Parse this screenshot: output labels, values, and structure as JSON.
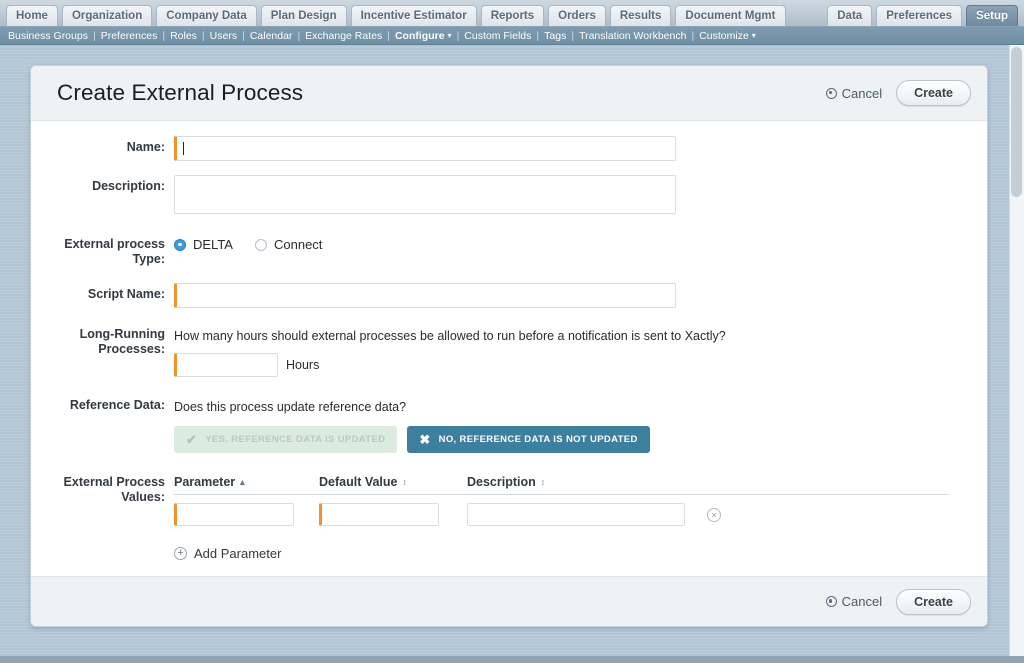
{
  "topnav": {
    "tabs": [
      {
        "label": "Home",
        "active": false
      },
      {
        "label": "Organization",
        "active": false
      },
      {
        "label": "Company Data",
        "active": false
      },
      {
        "label": "Plan Design",
        "active": false
      },
      {
        "label": "Incentive Estimator",
        "active": false
      },
      {
        "label": "Reports",
        "active": false
      },
      {
        "label": "Orders",
        "active": false
      },
      {
        "label": "Results",
        "active": false
      },
      {
        "label": "Document Mgmt",
        "active": false
      }
    ],
    "right_tabs": [
      {
        "label": "Data",
        "active": false
      },
      {
        "label": "Preferences",
        "active": false
      },
      {
        "label": "Setup",
        "active": true
      }
    ]
  },
  "subnav": {
    "items": [
      {
        "label": "Business Groups",
        "bold": false,
        "caret": false
      },
      {
        "label": "Preferences",
        "bold": false,
        "caret": false
      },
      {
        "label": "Roles",
        "bold": false,
        "caret": false
      },
      {
        "label": "Users",
        "bold": false,
        "caret": false
      },
      {
        "label": "Calendar",
        "bold": false,
        "caret": false
      },
      {
        "label": "Exchange Rates",
        "bold": false,
        "caret": false
      },
      {
        "label": "Configure",
        "bold": true,
        "caret": true
      },
      {
        "label": "Custom Fields",
        "bold": false,
        "caret": false
      },
      {
        "label": "Tags",
        "bold": false,
        "caret": false
      },
      {
        "label": "Translation Workbench",
        "bold": false,
        "caret": false
      },
      {
        "label": "Customize",
        "bold": false,
        "caret": true
      }
    ],
    "separator": "|",
    "caret_glyph": "▾"
  },
  "page": {
    "title": "Create External Process",
    "cancel_label": "Cancel",
    "create_label": "Create",
    "footer_cancel_label": "Cancel",
    "footer_create_label": "Create"
  },
  "form": {
    "name": {
      "label": "Name:",
      "value": "",
      "placeholder": "",
      "required": true
    },
    "description": {
      "label": "Description:",
      "value": "",
      "placeholder": "",
      "required": false
    },
    "external_process_type": {
      "label": "External process Type:",
      "label_line1": "External process",
      "label_line2": "Type:",
      "options": [
        {
          "label": "DELTA",
          "selected": true
        },
        {
          "label": "Connect",
          "selected": false
        }
      ]
    },
    "script_name": {
      "label": "Script Name:",
      "value": "",
      "placeholder": "",
      "required": true
    },
    "long_running": {
      "label_line1": "Long-Running",
      "label_line2": "Processes:",
      "question": "How many hours should external processes be allowed to run before a notification is sent to Xactly?",
      "value": "",
      "unit_label": "Hours",
      "required": true
    },
    "reference_data": {
      "label": "Reference Data:",
      "question": "Does this process update reference data?",
      "yes_label": "YES, REFERENCE DATA IS UPDATED",
      "yes_icon": "✔",
      "yes_selected": false,
      "no_label": "NO, REFERENCE DATA IS NOT UPDATED",
      "no_icon": "✖",
      "no_selected": true
    },
    "external_process_values": {
      "label_line1": "External Process",
      "label_line2": "Values:",
      "columns": [
        {
          "label": "Parameter",
          "sort": "asc",
          "glyph": "▴"
        },
        {
          "label": "Default Value",
          "sort": "none",
          "glyph": "↕"
        },
        {
          "label": "Description",
          "sort": "none",
          "glyph": "↕"
        }
      ],
      "rows": [
        {
          "parameter": "",
          "default_value": "",
          "description": "",
          "remove_icon": "×"
        }
      ],
      "add_label": "Add Parameter",
      "add_icon": "+"
    }
  },
  "colors": {
    "accent_required": "#f0932b",
    "radio_selected": "#3b9ae1",
    "toggle_no_bg": "#3d7f9e",
    "toggle_yes_bg": "#dcebdf",
    "page_bg": "#b3c6d6",
    "subnav_bg": "#7191a7"
  }
}
